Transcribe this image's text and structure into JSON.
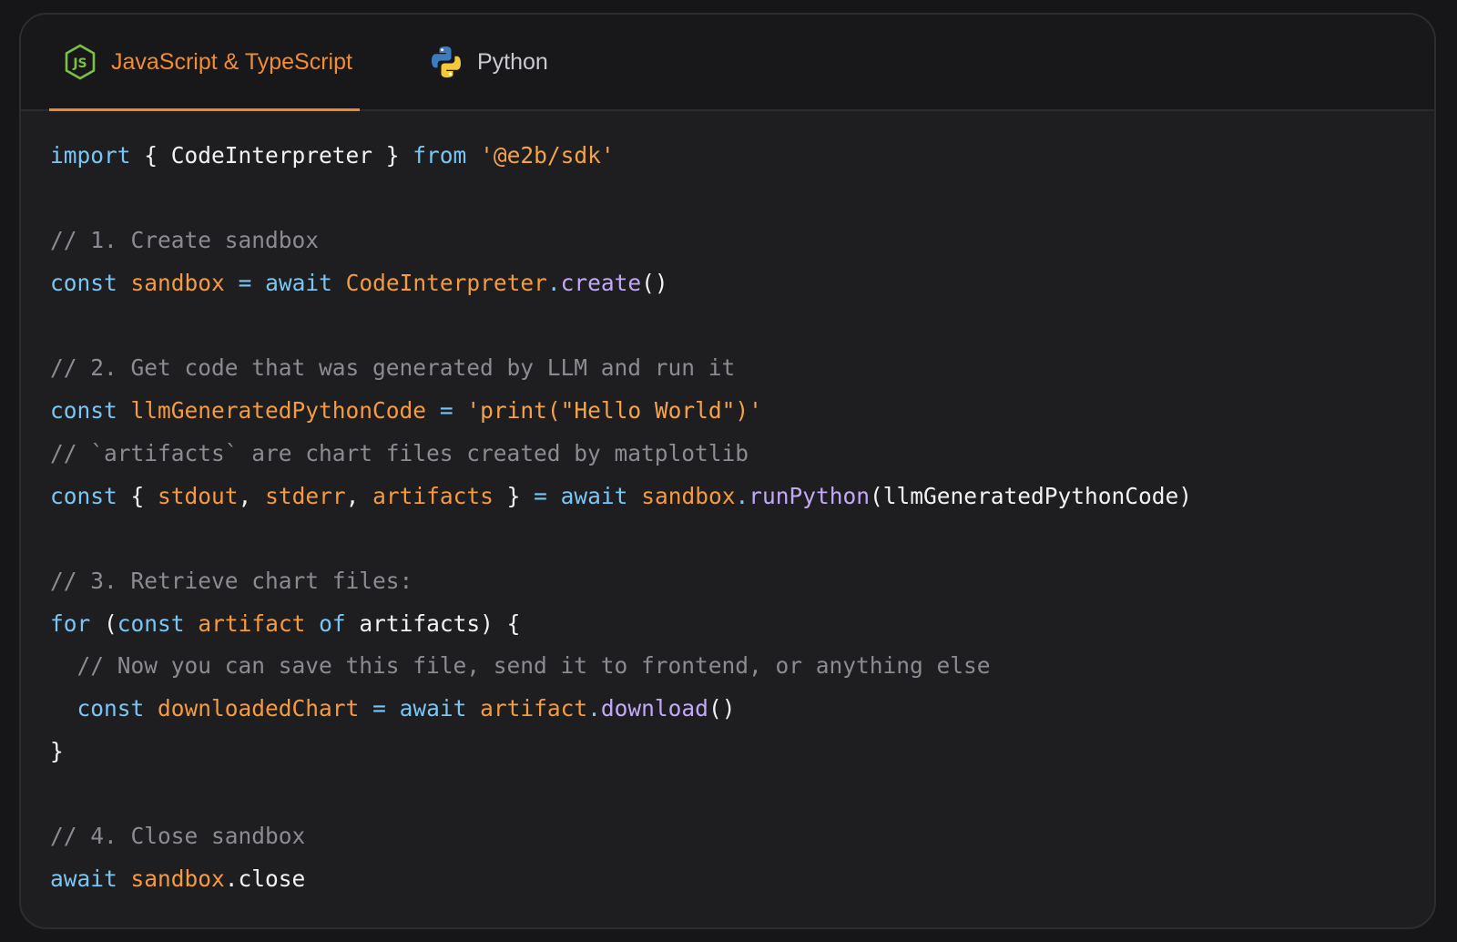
{
  "tabs": [
    {
      "label": "JavaScript & TypeScript",
      "icon": "nodejs-icon",
      "active": true
    },
    {
      "label": "Python",
      "icon": "python-icon",
      "active": false
    }
  ],
  "colors": {
    "accent": "#ef8a34",
    "keyword": "#79c6f4",
    "identifier": "#f59a3f",
    "function": "#c2a8f6",
    "comment": "#8b8b92",
    "text": "#f2f2f4"
  },
  "code_lines": [
    [
      [
        "kw",
        "import"
      ],
      [
        "pl",
        " { CodeInterpreter } "
      ],
      [
        "kw",
        "from"
      ],
      [
        "pl",
        " "
      ],
      [
        "str",
        "'@e2b/sdk'"
      ]
    ],
    [],
    [
      [
        "cm",
        "// 1. Create sandbox"
      ]
    ],
    [
      [
        "kw",
        "const"
      ],
      [
        "pl",
        " "
      ],
      [
        "id",
        "sandbox"
      ],
      [
        "pl",
        " "
      ],
      [
        "kw",
        "="
      ],
      [
        "pl",
        " "
      ],
      [
        "kw",
        "await"
      ],
      [
        "pl",
        " "
      ],
      [
        "id",
        "CodeInterpreter"
      ],
      [
        "kw",
        "."
      ],
      [
        "fn",
        "create"
      ],
      [
        "pl",
        "()"
      ]
    ],
    [],
    [
      [
        "cm",
        "// 2. Get code that was generated by LLM and run it"
      ]
    ],
    [
      [
        "kw",
        "const"
      ],
      [
        "pl",
        " "
      ],
      [
        "id",
        "llmGeneratedPythonCode"
      ],
      [
        "pl",
        " "
      ],
      [
        "kw",
        "="
      ],
      [
        "pl",
        " "
      ],
      [
        "str",
        "'print(\"Hello World\")'"
      ]
    ],
    [
      [
        "cm",
        "// `artifacts` are chart files created by matplotlib"
      ]
    ],
    [
      [
        "kw",
        "const"
      ],
      [
        "pl",
        " { "
      ],
      [
        "id",
        "stdout"
      ],
      [
        "pl",
        ", "
      ],
      [
        "id",
        "stderr"
      ],
      [
        "pl",
        ", "
      ],
      [
        "id",
        "artifacts"
      ],
      [
        "pl",
        " } "
      ],
      [
        "kw",
        "="
      ],
      [
        "pl",
        " "
      ],
      [
        "kw",
        "await"
      ],
      [
        "pl",
        " "
      ],
      [
        "id",
        "sandbox"
      ],
      [
        "kw",
        "."
      ],
      [
        "fn",
        "runPython"
      ],
      [
        "pl",
        "(llmGeneratedPythonCode)"
      ]
    ],
    [],
    [
      [
        "cm",
        "// 3. Retrieve chart files:"
      ]
    ],
    [
      [
        "kw",
        "for"
      ],
      [
        "pl",
        " ("
      ],
      [
        "kw",
        "const"
      ],
      [
        "pl",
        " "
      ],
      [
        "id",
        "artifact"
      ],
      [
        "pl",
        " "
      ],
      [
        "kw",
        "of"
      ],
      [
        "pl",
        " artifacts) {"
      ]
    ],
    [
      [
        "pl",
        "  "
      ],
      [
        "cm",
        "// Now you can save this file, send it to frontend, or anything else"
      ]
    ],
    [
      [
        "pl",
        "  "
      ],
      [
        "kw",
        "const"
      ],
      [
        "pl",
        " "
      ],
      [
        "id",
        "downloadedChart"
      ],
      [
        "pl",
        " "
      ],
      [
        "kw",
        "="
      ],
      [
        "pl",
        " "
      ],
      [
        "kw",
        "await"
      ],
      [
        "pl",
        " "
      ],
      [
        "id",
        "artifact"
      ],
      [
        "kw",
        "."
      ],
      [
        "fn",
        "download"
      ],
      [
        "pl",
        "()"
      ]
    ],
    [
      [
        "pl",
        "}"
      ]
    ],
    [],
    [
      [
        "cm",
        "// 4. Close sandbox"
      ]
    ],
    [
      [
        "kw",
        "await"
      ],
      [
        "pl",
        " "
      ],
      [
        "id",
        "sandbox"
      ],
      [
        "pl",
        ".close"
      ]
    ]
  ]
}
